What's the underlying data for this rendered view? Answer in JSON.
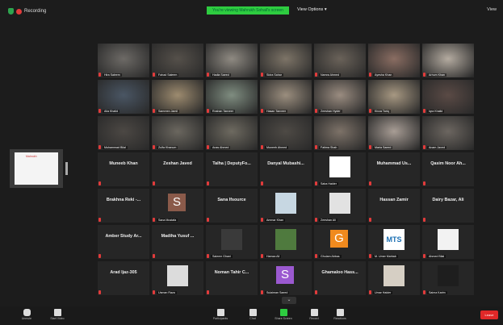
{
  "topbar": {
    "recording_label": "Recording",
    "sharing_text": "You're viewing Mahrukh Sohail's screen",
    "view_options_label": "View Options ▾",
    "view_button_label": "View"
  },
  "tiles": [
    {
      "name": "Hira Saleem",
      "bg": "#6d6a66",
      "kind": "video",
      "active": true
    },
    {
      "name": "Fahad Saleem",
      "bg": "#55504a",
      "kind": "video"
    },
    {
      "name": "Hadia Saeed",
      "bg": "#8f8a82",
      "kind": "video"
    },
    {
      "name": "Sidra Sahar",
      "bg": "#7d7467",
      "kind": "video"
    },
    {
      "name": "Namra Ahmed",
      "bg": "#6a6259",
      "kind": "video"
    },
    {
      "name": "Ayesha Khan",
      "bg": "#8a6d62",
      "kind": "video"
    },
    {
      "name": "Arhum Khan",
      "bg": "#b4aba0",
      "kind": "video"
    },
    {
      "name": "Alia Khalid",
      "bg": "#4a5664",
      "kind": "video"
    },
    {
      "name": "Samreen Jamil",
      "bg": "#9d8b6f",
      "kind": "video"
    },
    {
      "name": "Roshan Tanveer",
      "bg": "#7f8d80",
      "kind": "video"
    },
    {
      "name": "Hasan Tanveer",
      "bg": "#9b8e7e",
      "kind": "video"
    },
    {
      "name": "Zeeshan Hyder",
      "bg": "#9a8c80",
      "kind": "video"
    },
    {
      "name": "Kinza Tariq",
      "bg": "#a79882",
      "kind": "video"
    },
    {
      "name": "Iqra Khalid",
      "bg": "#5a4a45",
      "kind": "video"
    },
    {
      "name": "Muhammad Bilal",
      "bg": "#4c4844",
      "kind": "video"
    },
    {
      "name": "Zulfa Khanum",
      "bg": "#6b675f",
      "kind": "video"
    },
    {
      "name": "Anas Ahmed",
      "bg": "#6e6a60",
      "kind": "video"
    },
    {
      "name": "Muneeb Ahmed",
      "bg": "#4e4a45",
      "kind": "video"
    },
    {
      "name": "Fatima Shah",
      "bg": "#7d7268",
      "kind": "video"
    },
    {
      "name": "Maria Saeed",
      "bg": "#a89d95",
      "kind": "video"
    },
    {
      "name": "Anam Javed",
      "bg": "#6c6660",
      "kind": "video"
    },
    {
      "name": "Muneeb Khan",
      "kind": "name"
    },
    {
      "name": "Zeshan Javed",
      "kind": "name"
    },
    {
      "name": "Talha | DeputyFo...",
      "kind": "name"
    },
    {
      "name": "Danyal Mubashi...",
      "kind": "name"
    },
    {
      "name": "Saba Haider",
      "kind": "photo",
      "photo_bg": "#ffffff"
    },
    {
      "name": "Muhammad Us...",
      "kind": "name"
    },
    {
      "name": "Qasim Noor Ah...",
      "kind": "name"
    },
    {
      "name": "Brakhna Reki -...",
      "kind": "name"
    },
    {
      "name": "Sana Mustafa",
      "kind": "avatar",
      "initial": "S",
      "avatar_bg": "#8a5a4a"
    },
    {
      "name": "Sana Ifsource",
      "kind": "name"
    },
    {
      "name": "Ammar Khan",
      "kind": "photo",
      "photo_bg": "#c7d7e2"
    },
    {
      "name": "Zeeshan Ali",
      "kind": "photo",
      "photo_bg": "#e2e2e2"
    },
    {
      "name": "Hassan Zamir",
      "kind": "name"
    },
    {
      "name": "Dairy Bazar, Ali",
      "kind": "name"
    },
    {
      "name": "Amber Study Ar...",
      "kind": "name"
    },
    {
      "name": "Madiha Yusuf ...",
      "kind": "name"
    },
    {
      "name": "Saleem Ghani",
      "kind": "photo",
      "photo_bg": "#3a3a3a"
    },
    {
      "name": "Hamza Ali",
      "kind": "photo",
      "photo_bg": "#4f7a3e"
    },
    {
      "name": "Ghulam Abbas",
      "kind": "avatar",
      "initial": "G",
      "avatar_bg": "#f08a1e"
    },
    {
      "name": "M. Umer Mahtab",
      "kind": "logo",
      "logo_text": "MTS"
    },
    {
      "name": "Ahmed Bilal",
      "kind": "photo",
      "photo_bg": "#f2f2f2"
    },
    {
      "name": "Arad Ijaz-305",
      "kind": "name"
    },
    {
      "name": "Usman Raza",
      "kind": "photo",
      "photo_bg": "#dcdcdc"
    },
    {
      "name": "Noman Tahir C...",
      "kind": "name"
    },
    {
      "name": "Sulaiman Saeed",
      "kind": "avatar",
      "initial": "S",
      "avatar_bg": "#9b59d0"
    },
    {
      "name": "Ghamaloo Hass...",
      "kind": "name"
    },
    {
      "name": "Umar Haider",
      "kind": "photo",
      "photo_bg": "#d6cfc4"
    },
    {
      "name": "Saima Karim",
      "kind": "photo",
      "photo_bg": "#1e1e1e"
    }
  ],
  "self_view": {
    "screen_text": "Mahrukh"
  },
  "toolbar": {
    "items": [
      {
        "name": "unmute",
        "label": "Unmute",
        "icon": "microphone-icon"
      },
      {
        "name": "start-video",
        "label": "Start Video",
        "icon": "video-camera-icon"
      },
      {
        "name": "participants",
        "label": "Participants",
        "icon": "people-icon"
      },
      {
        "name": "chat",
        "label": "Chat",
        "icon": "chat-icon"
      },
      {
        "name": "share-screen",
        "label": "Share Screen",
        "icon": "share-screen-icon"
      },
      {
        "name": "record",
        "label": "Record",
        "icon": "record-icon"
      },
      {
        "name": "reactions",
        "label": "Reactions",
        "icon": "smile-icon"
      }
    ],
    "end_label": "Leave"
  },
  "colors": {
    "background": "#1c1c1c",
    "active_speaker": "#9bd94a",
    "sharing_banner": "#2ecc40",
    "end_button": "#e02828",
    "muted": "#e23b3b"
  }
}
